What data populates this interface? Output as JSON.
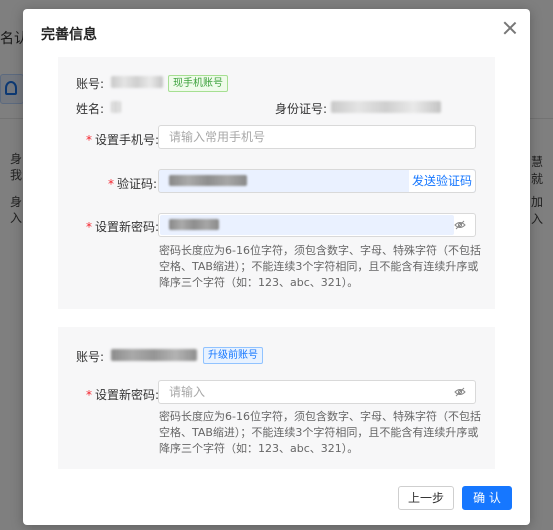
{
  "background": {
    "title_fragment": "名认",
    "left_lines": [
      "身",
      "我",
      "身",
      "入"
    ],
    "right_lines": [
      "慧就",
      "加入"
    ]
  },
  "dialog": {
    "title": "完善信息",
    "section_current": {
      "account_label": "账号:",
      "account_tag": "现手机账号",
      "name_label": "姓名:",
      "id_label": "身份证号:",
      "phone_label": "设置手机号:",
      "phone_placeholder": "请输入常用手机号",
      "code_label": "验证码:",
      "send_code": "发送验证码",
      "password_label": "设置新密码:",
      "password_hint": "密码长度应为6-16位字符，须包含数字、字母、特殊字符（不包括空格、TAB缩进）；不能连续3个字符相同，且不能含有连续升序或降序三个字符（如：123、abc、321）。"
    },
    "section_legacy": {
      "account_label": "账号:",
      "account_tag": "升级前账号",
      "password_label": "设置新密码:",
      "password_placeholder": "请输入",
      "password_hint": "密码长度应为6-16位字符，须包含数字、字母、特殊字符（不包括空格、TAB缩进）；不能连续3个字符相同，且不能含有连续升序或降序三个字符（如：123、abc、321）。"
    },
    "buttons": {
      "prev": "上一步",
      "confirm": "确 认"
    }
  },
  "colors": {
    "primary": "#1677ff",
    "required": "#f5222d",
    "tag_green": "#3ca13c",
    "section_bg": "#f7f7f8"
  }
}
